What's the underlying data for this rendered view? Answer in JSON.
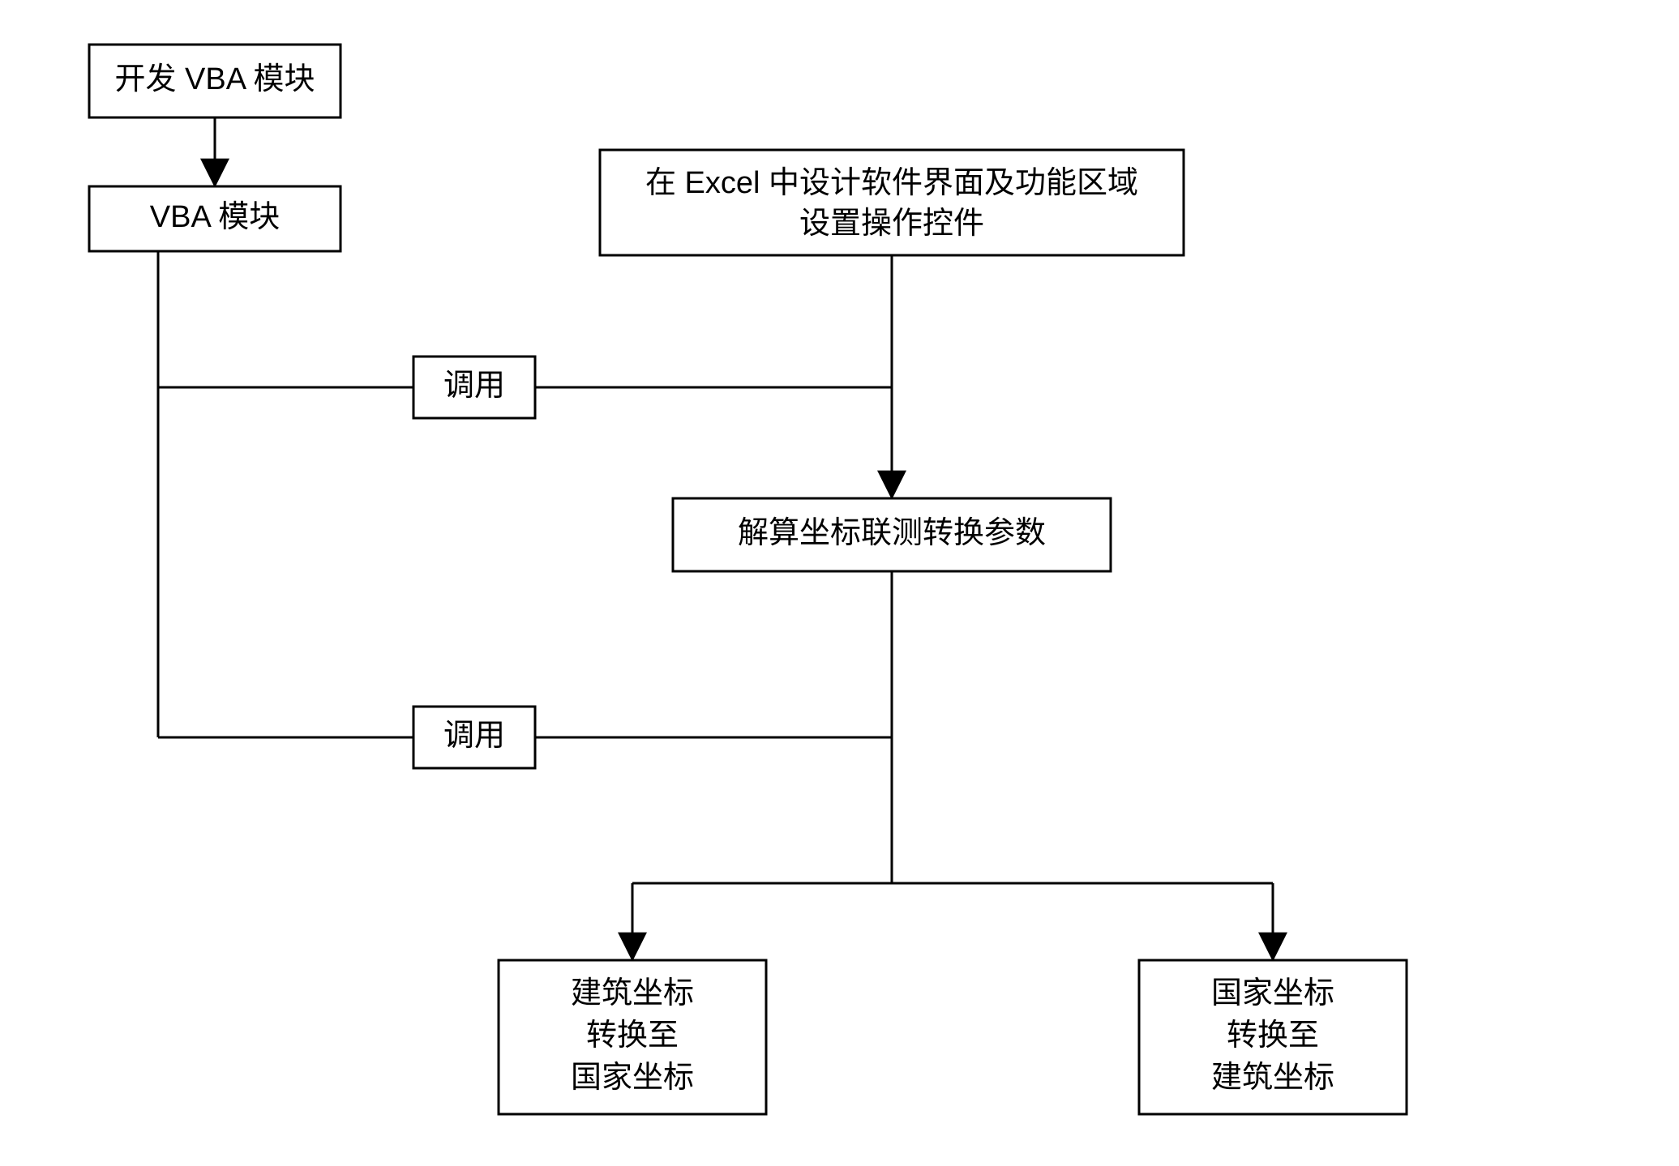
{
  "nodes": {
    "dev_vba": {
      "label": "开发 VBA 模块"
    },
    "vba_module": {
      "label": "VBA 模块"
    },
    "excel_ui": {
      "line1": "在 Excel 中设计软件界面及功能区域",
      "line2": "设置操作控件"
    },
    "call1": {
      "label": "调用"
    },
    "solve_params": {
      "label": "解算坐标联测转换参数"
    },
    "call2": {
      "label": "调用"
    },
    "build_to_nat": {
      "line1": "建筑坐标",
      "line2": "转换至",
      "line3": "国家坐标"
    },
    "nat_to_build": {
      "line1": "国家坐标",
      "line2": "转换至",
      "line3": "建筑坐标"
    }
  }
}
